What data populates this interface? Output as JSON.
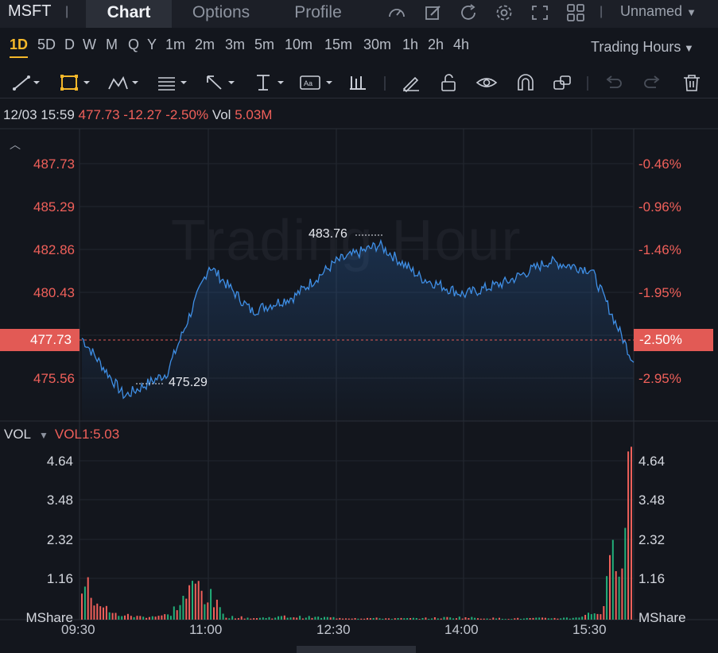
{
  "header": {
    "symbol": "MSFT",
    "separator": "|",
    "tabs": [
      {
        "label": "Chart",
        "active": true
      },
      {
        "label": "Options",
        "active": false
      },
      {
        "label": "Profile",
        "active": false
      }
    ],
    "icons": [
      "gauge-icon",
      "edit-icon",
      "refresh-icon",
      "settings-icon",
      "fullscreen-icon",
      "grid-layout-icon"
    ],
    "layout_name": "Unnamed"
  },
  "periods": {
    "items": [
      "1D",
      "5D",
      "D",
      "W",
      "M",
      "Q",
      "Y",
      "1m",
      "2m",
      "3m",
      "5m",
      "10m",
      "15m",
      "30m",
      "1h",
      "2h",
      "4h"
    ],
    "active": "1D",
    "session": "Trading Hours"
  },
  "tools": [
    "trend-line-icon",
    "rectangle-icon",
    "pattern-icon",
    "fibonacci-icon",
    "arrow-icon",
    "measure-icon",
    "text-annotation-icon",
    "bars-icon",
    "pencil-icon",
    "lock-icon",
    "eye-icon",
    "magnet-icon",
    "group-icon",
    "undo-icon",
    "redo-icon",
    "delete-icon"
  ],
  "quote": {
    "datetime": "12/03 15:59",
    "price": "477.73",
    "change": "-12.27",
    "change_pct": "-2.50%",
    "vol_label": "Vol",
    "volume": "5.03M"
  },
  "price_axis": [
    "487.73",
    "485.29",
    "482.86",
    "480.43",
    "477.73",
    "475.56"
  ],
  "pct_axis": [
    "-0.46%",
    "-0.96%",
    "-1.46%",
    "-1.95%",
    "-2.50%",
    "-2.95%"
  ],
  "current_price_tag": "477.73",
  "current_pct_tag": "-2.50%",
  "watermark": "Trading Hour",
  "high_label": "483.76",
  "low_label": "475.29",
  "volume_panel": {
    "title": "VOL",
    "indicator": "VOL1:5.03",
    "axis": [
      "4.64",
      "3.48",
      "2.32",
      "1.16"
    ],
    "unit": "MShare"
  },
  "time_axis": [
    "09:30",
    "11:00",
    "12:30",
    "14:00",
    "15:30"
  ],
  "colors": {
    "background": "#13161d",
    "line": "#3f8fe6",
    "down": "#f0605a",
    "up": "#22b07a",
    "accent": "#f5b82a"
  },
  "chart_data": {
    "type": "line",
    "x": [
      "09:30",
      "10:00",
      "10:30",
      "11:00",
      "11:30",
      "12:00",
      "12:30",
      "13:00",
      "13:30",
      "14:00",
      "14:30",
      "15:00",
      "15:30",
      "16:00"
    ],
    "series": [
      {
        "values": [
          478.9,
          476.1,
          477.2,
          482.4,
          480.2,
          480.9,
          482.6,
          483.4,
          481.8,
          481.0,
          481.6,
          482.6,
          482.2,
          477.73
        ]
      }
    ],
    "ylim": [
      474.9,
      489.0
    ],
    "volume": [
      1.2,
      0.2,
      0.1,
      0.15,
      1.2,
      0.1,
      0.05,
      0.1,
      0.08,
      0.06,
      0.05,
      0.04,
      0.05,
      0.08,
      0.05,
      0.04,
      0.05,
      0.06,
      0.3,
      5.03
    ],
    "volume_ylim": [
      0,
      5.2
    ]
  }
}
